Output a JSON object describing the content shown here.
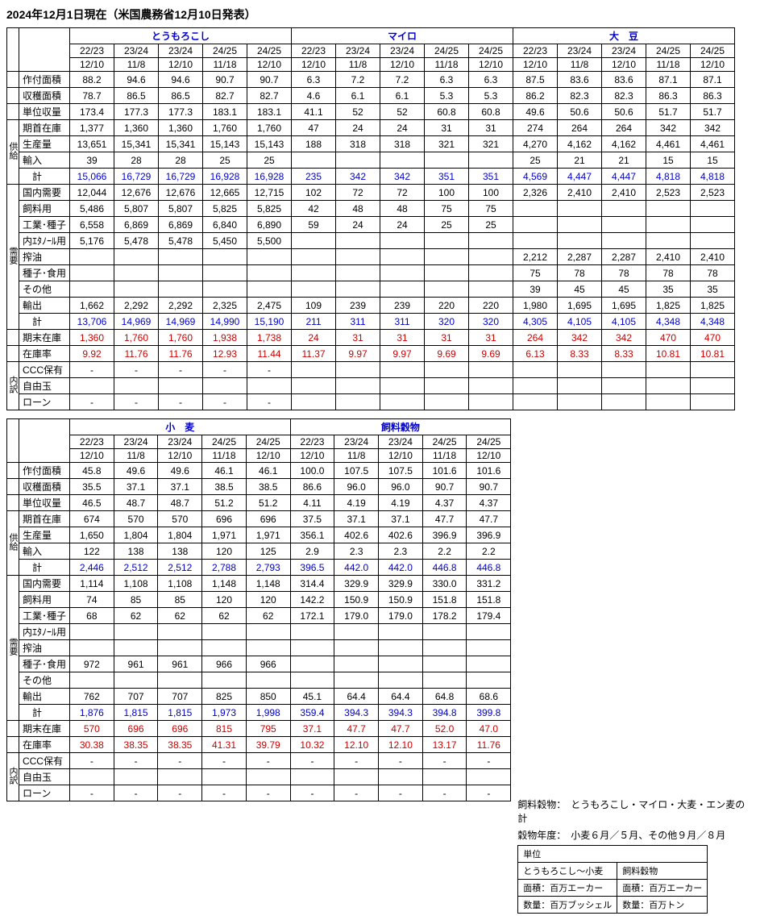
{
  "title": "2024年12月1日現在（米国農務省12月10日発表）",
  "commodities_top": [
    "とうもろこし",
    "マイロ",
    "大　豆"
  ],
  "commodities_bot": [
    "小　麦",
    "飼料穀物"
  ],
  "years": [
    "22/23",
    "23/24",
    "23/24",
    "24/25",
    "24/25"
  ],
  "dates": [
    "12/10",
    "11/8",
    "12/10",
    "11/18",
    "12/10"
  ],
  "side_labels": {
    "supply": "供給",
    "demand": "需要",
    "breakdown": "内訳"
  },
  "row_labels": {
    "planted": "作付面積",
    "harvested": "収穫面積",
    "yield": "単位収量",
    "begstk": "期首在庫",
    "prod": "生産量",
    "import": "輸入",
    "supsum": "　計",
    "domestic": "国内需要",
    "feed": "飼料用",
    "indseed": "工業･種子",
    "ethanol": "内ｴﾀﾉｰﾙ用",
    "crush": "搾油",
    "seedfood": "種子･食用",
    "other": "その他",
    "export": "輸出",
    "demsum": "　計",
    "endstk": "期末在庫",
    "ratio": "在庫率",
    "ccc": "CCC保有",
    "free": "自由玉",
    "loan": "ローン"
  },
  "notes": {
    "line1a": "飼料穀物：",
    "line1b": "とうもろこし・マイロ・大麦・エン麦の計",
    "line2a": "穀物年度：",
    "line2b": "小麦６月／５月、その他９月／８月"
  },
  "unitbox": {
    "header": "単位",
    "h1": "とうもろこし～小麦",
    "h2": "飼料穀物",
    "a1": "面積：百万エーカー",
    "a2": "面積：百万エーカー",
    "q1": "数量：百万ブッシェル",
    "q2": "数量：百万トン"
  },
  "chart_data": [
    {
      "type": "table",
      "commodity": "とうもろこし",
      "columns": {
        "year": [
          "22/23",
          "23/24",
          "23/24",
          "24/25",
          "24/25"
        ],
        "date": [
          "12/10",
          "11/8",
          "12/10",
          "11/18",
          "12/10"
        ]
      },
      "rows": {
        "planted": [
          "88.2",
          "94.6",
          "94.6",
          "90.7",
          "90.7"
        ],
        "harvested": [
          "78.7",
          "86.5",
          "86.5",
          "82.7",
          "82.7"
        ],
        "yield": [
          "173.4",
          "177.3",
          "177.3",
          "183.1",
          "183.1"
        ],
        "begstk": [
          "1,377",
          "1,360",
          "1,360",
          "1,760",
          "1,760"
        ],
        "prod": [
          "13,651",
          "15,341",
          "15,341",
          "15,143",
          "15,143"
        ],
        "import": [
          "39",
          "28",
          "28",
          "25",
          "25"
        ],
        "supsum": [
          "15,066",
          "16,729",
          "16,729",
          "16,928",
          "16,928"
        ],
        "domestic": [
          "12,044",
          "12,676",
          "12,676",
          "12,665",
          "12,715"
        ],
        "feed": [
          "5,486",
          "5,807",
          "5,807",
          "5,825",
          "5,825"
        ],
        "indseed": [
          "6,558",
          "6,869",
          "6,869",
          "6,840",
          "6,890"
        ],
        "ethanol": [
          "5,176",
          "5,478",
          "5,478",
          "5,450",
          "5,500"
        ],
        "crush": [
          "",
          "",
          "",
          "",
          ""
        ],
        "seedfood": [
          "",
          "",
          "",
          "",
          ""
        ],
        "other": [
          "",
          "",
          "",
          "",
          ""
        ],
        "export": [
          "1,662",
          "2,292",
          "2,292",
          "2,325",
          "2,475"
        ],
        "demsum": [
          "13,706",
          "14,969",
          "14,969",
          "14,990",
          "15,190"
        ],
        "endstk": [
          "1,360",
          "1,760",
          "1,760",
          "1,938",
          "1,738"
        ],
        "ratio": [
          "9.92",
          "11.76",
          "11.76",
          "12.93",
          "11.44"
        ],
        "ccc": [
          "-",
          "-",
          "-",
          "-",
          "-"
        ],
        "free": [
          "",
          "",
          "",
          "",
          ""
        ],
        "loan": [
          "-",
          "-",
          "-",
          "-",
          "-"
        ]
      }
    },
    {
      "type": "table",
      "commodity": "マイロ",
      "columns": {
        "year": [
          "22/23",
          "23/24",
          "23/24",
          "24/25",
          "24/25"
        ],
        "date": [
          "12/10",
          "11/8",
          "12/10",
          "11/18",
          "12/10"
        ]
      },
      "rows": {
        "planted": [
          "6.3",
          "7.2",
          "7.2",
          "6.3",
          "6.3"
        ],
        "harvested": [
          "4.6",
          "6.1",
          "6.1",
          "5.3",
          "5.3"
        ],
        "yield": [
          "41.1",
          "52",
          "52",
          "60.8",
          "60.8"
        ],
        "begstk": [
          "47",
          "24",
          "24",
          "31",
          "31"
        ],
        "prod": [
          "188",
          "318",
          "318",
          "321",
          "321"
        ],
        "import": [
          "",
          "",
          "",
          "",
          ""
        ],
        "supsum": [
          "235",
          "342",
          "342",
          "351",
          "351"
        ],
        "domestic": [
          "102",
          "72",
          "72",
          "100",
          "100"
        ],
        "feed": [
          "42",
          "48",
          "48",
          "75",
          "75"
        ],
        "indseed": [
          "59",
          "24",
          "24",
          "25",
          "25"
        ],
        "ethanol": [
          "",
          "",
          "",
          "",
          ""
        ],
        "crush": [
          "",
          "",
          "",
          "",
          ""
        ],
        "seedfood": [
          "",
          "",
          "",
          "",
          ""
        ],
        "other": [
          "",
          "",
          "",
          "",
          ""
        ],
        "export": [
          "109",
          "239",
          "239",
          "220",
          "220"
        ],
        "demsum": [
          "211",
          "311",
          "311",
          "320",
          "320"
        ],
        "endstk": [
          "24",
          "31",
          "31",
          "31",
          "31"
        ],
        "ratio": [
          "11.37",
          "9.97",
          "9.97",
          "9.69",
          "9.69"
        ],
        "ccc": [
          "",
          "",
          "",
          "",
          ""
        ],
        "free": [
          "",
          "",
          "",
          "",
          ""
        ],
        "loan": [
          "",
          "",
          "",
          "",
          ""
        ]
      }
    },
    {
      "type": "table",
      "commodity": "大豆",
      "columns": {
        "year": [
          "22/23",
          "23/24",
          "23/24",
          "24/25",
          "24/25"
        ],
        "date": [
          "12/10",
          "11/8",
          "12/10",
          "11/18",
          "12/10"
        ]
      },
      "rows": {
        "planted": [
          "87.5",
          "83.6",
          "83.6",
          "87.1",
          "87.1"
        ],
        "harvested": [
          "86.2",
          "82.3",
          "82.3",
          "86.3",
          "86.3"
        ],
        "yield": [
          "49.6",
          "50.6",
          "50.6",
          "51.7",
          "51.7"
        ],
        "begstk": [
          "274",
          "264",
          "264",
          "342",
          "342"
        ],
        "prod": [
          "4,270",
          "4,162",
          "4,162",
          "4,461",
          "4,461"
        ],
        "import": [
          "25",
          "21",
          "21",
          "15",
          "15"
        ],
        "supsum": [
          "4,569",
          "4,447",
          "4,447",
          "4,818",
          "4,818"
        ],
        "domestic": [
          "2,326",
          "2,410",
          "2,410",
          "2,523",
          "2,523"
        ],
        "feed": [
          "",
          "",
          "",
          "",
          ""
        ],
        "indseed": [
          "",
          "",
          "",
          "",
          ""
        ],
        "ethanol": [
          "",
          "",
          "",
          "",
          ""
        ],
        "crush": [
          "2,212",
          "2,287",
          "2,287",
          "2,410",
          "2,410"
        ],
        "seedfood": [
          "75",
          "78",
          "78",
          "78",
          "78"
        ],
        "other": [
          "39",
          "45",
          "45",
          "35",
          "35"
        ],
        "export": [
          "1,980",
          "1,695",
          "1,695",
          "1,825",
          "1,825"
        ],
        "demsum": [
          "4,305",
          "4,105",
          "4,105",
          "4,348",
          "4,348"
        ],
        "endstk": [
          "264",
          "342",
          "342",
          "470",
          "470"
        ],
        "ratio": [
          "6.13",
          "8.33",
          "8.33",
          "10.81",
          "10.81"
        ],
        "ccc": [
          "",
          "",
          "",
          "",
          ""
        ],
        "free": [
          "",
          "",
          "",
          "",
          ""
        ],
        "loan": [
          "",
          "",
          "",
          "",
          ""
        ]
      }
    },
    {
      "type": "table",
      "commodity": "小麦",
      "columns": {
        "year": [
          "22/23",
          "23/24",
          "23/24",
          "24/25",
          "24/25"
        ],
        "date": [
          "12/10",
          "11/8",
          "12/10",
          "11/18",
          "12/10"
        ]
      },
      "rows": {
        "planted": [
          "45.8",
          "49.6",
          "49.6",
          "46.1",
          "46.1"
        ],
        "harvested": [
          "35.5",
          "37.1",
          "37.1",
          "38.5",
          "38.5"
        ],
        "yield": [
          "46.5",
          "48.7",
          "48.7",
          "51.2",
          "51.2"
        ],
        "begstk": [
          "674",
          "570",
          "570",
          "696",
          "696"
        ],
        "prod": [
          "1,650",
          "1,804",
          "1,804",
          "1,971",
          "1,971"
        ],
        "import": [
          "122",
          "138",
          "138",
          "120",
          "125"
        ],
        "supsum": [
          "2,446",
          "2,512",
          "2,512",
          "2,788",
          "2,793"
        ],
        "domestic": [
          "1,114",
          "1,108",
          "1,108",
          "1,148",
          "1,148"
        ],
        "feed": [
          "74",
          "85",
          "85",
          "120",
          "120"
        ],
        "indseed": [
          "68",
          "62",
          "62",
          "62",
          "62"
        ],
        "ethanol": [
          "",
          "",
          "",
          "",
          ""
        ],
        "crush": [
          "",
          "",
          "",
          "",
          ""
        ],
        "seedfood": [
          "972",
          "961",
          "961",
          "966",
          "966"
        ],
        "other": [
          "",
          "",
          "",
          "",
          ""
        ],
        "export": [
          "762",
          "707",
          "707",
          "825",
          "850"
        ],
        "demsum": [
          "1,876",
          "1,815",
          "1,815",
          "1,973",
          "1,998"
        ],
        "endstk": [
          "570",
          "696",
          "696",
          "815",
          "795"
        ],
        "ratio": [
          "30.38",
          "38.35",
          "38.35",
          "41.31",
          "39.79"
        ],
        "ccc": [
          "-",
          "-",
          "-",
          "-",
          "-"
        ],
        "free": [
          "",
          "",
          "",
          "",
          ""
        ],
        "loan": [
          "-",
          "-",
          "-",
          "-",
          "-"
        ]
      }
    },
    {
      "type": "table",
      "commodity": "飼料穀物",
      "columns": {
        "year": [
          "22/23",
          "23/24",
          "23/24",
          "24/25",
          "24/25"
        ],
        "date": [
          "12/10",
          "11/8",
          "12/10",
          "11/18",
          "12/10"
        ]
      },
      "rows": {
        "planted": [
          "100.0",
          "107.5",
          "107.5",
          "101.6",
          "101.6"
        ],
        "harvested": [
          "86.6",
          "96.0",
          "96.0",
          "90.7",
          "90.7"
        ],
        "yield": [
          "4.11",
          "4.19",
          "4.19",
          "4.37",
          "4.37"
        ],
        "begstk": [
          "37.5",
          "37.1",
          "37.1",
          "47.7",
          "47.7"
        ],
        "prod": [
          "356.1",
          "402.6",
          "402.6",
          "396.9",
          "396.9"
        ],
        "import": [
          "2.9",
          "2.3",
          "2.3",
          "2.2",
          "2.2"
        ],
        "supsum": [
          "396.5",
          "442.0",
          "442.0",
          "446.8",
          "446.8"
        ],
        "domestic": [
          "314.4",
          "329.9",
          "329.9",
          "330.0",
          "331.2"
        ],
        "feed": [
          "142.2",
          "150.9",
          "150.9",
          "151.8",
          "151.8"
        ],
        "indseed": [
          "172.1",
          "179.0",
          "179.0",
          "178.2",
          "179.4"
        ],
        "ethanol": [
          "",
          "",
          "",
          "",
          ""
        ],
        "crush": [
          "",
          "",
          "",
          "",
          ""
        ],
        "seedfood": [
          "",
          "",
          "",
          "",
          ""
        ],
        "other": [
          "",
          "",
          "",
          "",
          ""
        ],
        "export": [
          "45.1",
          "64.4",
          "64.4",
          "64.8",
          "68.6"
        ],
        "demsum": [
          "359.4",
          "394.3",
          "394.3",
          "394.8",
          "399.8"
        ],
        "endstk": [
          "37.1",
          "47.7",
          "47.7",
          "52.0",
          "47.0"
        ],
        "ratio": [
          "10.32",
          "12.10",
          "12.10",
          "13.17",
          "11.76"
        ],
        "ccc": [
          "-",
          "-",
          "-",
          "-",
          "-"
        ],
        "free": [
          "",
          "",
          "",
          "",
          ""
        ],
        "loan": [
          "-",
          "-",
          "-",
          "-",
          "-"
        ]
      }
    }
  ]
}
